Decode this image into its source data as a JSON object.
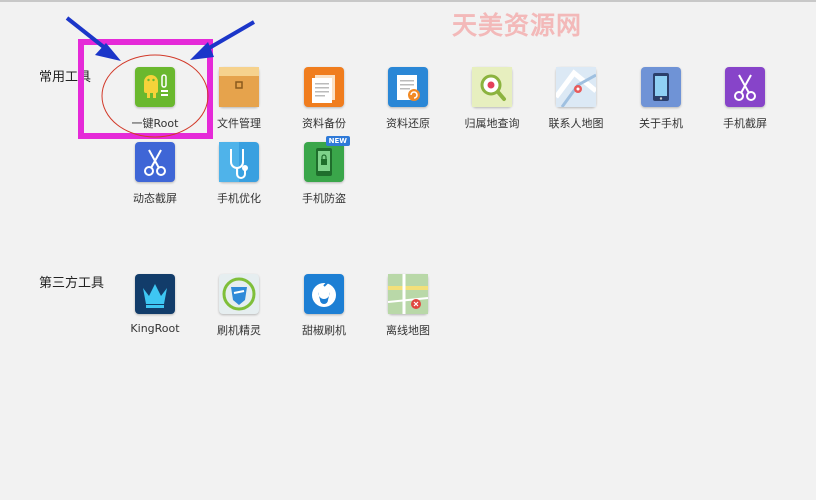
{
  "watermark": "天美资源网",
  "sections": {
    "common": {
      "label": "常用工具"
    },
    "third_party": {
      "label": "第三方工具"
    }
  },
  "tools": {
    "one_click_root": {
      "label": "一键Root",
      "color": "#6ab82e",
      "icon": "android-root-icon"
    },
    "file_manager": {
      "label": "文件管理",
      "color": "#e3a24a",
      "icon": "folder-icon"
    },
    "data_backup": {
      "label": "资料备份",
      "color": "#f07d1e",
      "icon": "document-stack-icon"
    },
    "data_restore": {
      "label": "资料还原",
      "color": "#2a87d6",
      "icon": "document-restore-icon"
    },
    "location_lookup": {
      "label": "归属地查询",
      "color": "#c9dc8a",
      "icon": "magnifier-icon"
    },
    "contact_map": {
      "label": "联系人地图",
      "color": "#bcd6ee",
      "icon": "map-pin-icon"
    },
    "about_phone": {
      "label": "关于手机",
      "color": "#6f93d6",
      "icon": "phone-icon"
    },
    "screenshot_1": {
      "label": "手机截屏",
      "color": "#8744c9",
      "icon": "scissors-icon"
    },
    "animated_screenshot": {
      "label": "动态截屏",
      "color": "#3f66d6",
      "icon": "scissors-icon"
    },
    "phone_optimize": {
      "label": "手机优化",
      "color": "#39a0e0",
      "icon": "stethoscope-icon"
    },
    "phone_antitheft": {
      "label": "手机防盗",
      "color": "#3aa64a",
      "icon": "phone-lock-icon",
      "badge": "NEW"
    },
    "kingroot": {
      "label": "KingRoot",
      "color": "#123c6a",
      "icon": "crown-icon"
    },
    "flash_wizard": {
      "label": "刷机精灵",
      "color": "#e6eef0",
      "icon": "shield-icon"
    },
    "pepper_flash": {
      "label": "甜椒刷机",
      "color": "#1d7fd4",
      "icon": "pepper-icon"
    },
    "offline_map": {
      "label": "离线地图",
      "color": "#9cc68a",
      "icon": "offline-map-icon"
    }
  }
}
